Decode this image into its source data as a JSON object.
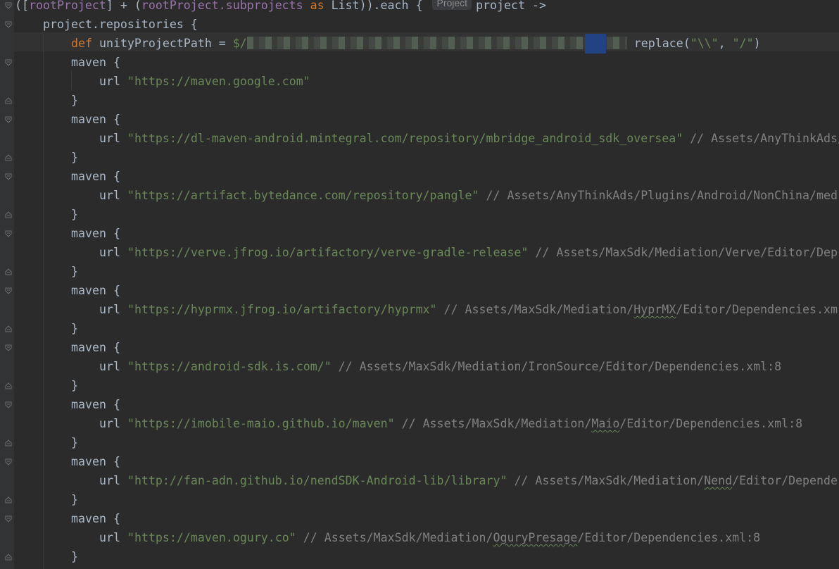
{
  "editor": {
    "inlay_hint": "Project",
    "lines": {
      "l1_open_paren": "(",
      "l1_bracket_open": "[",
      "l1_root_project": "rootProject",
      "l1_after_root": "] + (",
      "l1_root_project2": "rootProject",
      "l1_subprojects": ".subprojects ",
      "l1_as": "as",
      "l1_rest": " List)).each { ",
      "l1_param": "project ->",
      "l2": "project.repositories {",
      "l3_def": "def",
      "l3_var": " unityProjectPath = ",
      "l3_dollar": "$/",
      "l3_rest_a": " replace(",
      "l3_str1": "\"\\\\\"",
      "l3_comma": ", ",
      "l3_str2": "\"/\"",
      "l3_close": ")",
      "maven_label": "maven {",
      "url_label": "url ",
      "close_brace": "}"
    },
    "repositories": [
      {
        "url": "\"https://maven.google.com\"",
        "comment": ""
      },
      {
        "url": "\"https://dl-maven-android.mintegral.com/repository/mbridge_android_sdk_oversea\"",
        "comment": " // Assets/AnyThinkAds/"
      },
      {
        "url": "\"https://artifact.bytedance.com/repository/pangle\"",
        "comment": " // Assets/AnyThinkAds/Plugins/Android/NonChina/med"
      },
      {
        "url": "\"https://verve.jfrog.io/artifactory/verve-gradle-release\"",
        "comment": " // Assets/MaxSdk/Mediation/Verve/Editor/Dep"
      },
      {
        "url": "\"https://hyprmx.jfrog.io/artifactory/hyprmx\"",
        "comment_a": " // Assets/MaxSdk/Mediation/",
        "comment_squig": "HyprMX",
        "comment_b": "/Editor/Dependencies.xm"
      },
      {
        "url": "\"https://android-sdk.is.com/\"",
        "comment": " // Assets/MaxSdk/Mediation/IronSource/Editor/Dependencies.xml:8"
      },
      {
        "url": "\"https://imobile-maio.github.io/maven\"",
        "comment_a": " // Assets/MaxSdk/Mediation/",
        "comment_squig": "Maio",
        "comment_b": "/Editor/Dependencies.xml:8"
      },
      {
        "url": "\"http://fan-adn.github.io/nendSDK-Android-lib/library\"",
        "comment_a": " // Assets/MaxSdk/Mediation/",
        "comment_squig": "Nend",
        "comment_b": "/Editor/Depende"
      },
      {
        "url": "\"https://maven.ogury.co\"",
        "comment_a": " // Assets/MaxSdk/Mediation/",
        "comment_squig": "OguryPresage",
        "comment_b": "/Editor/Dependencies.xml:8"
      }
    ]
  }
}
